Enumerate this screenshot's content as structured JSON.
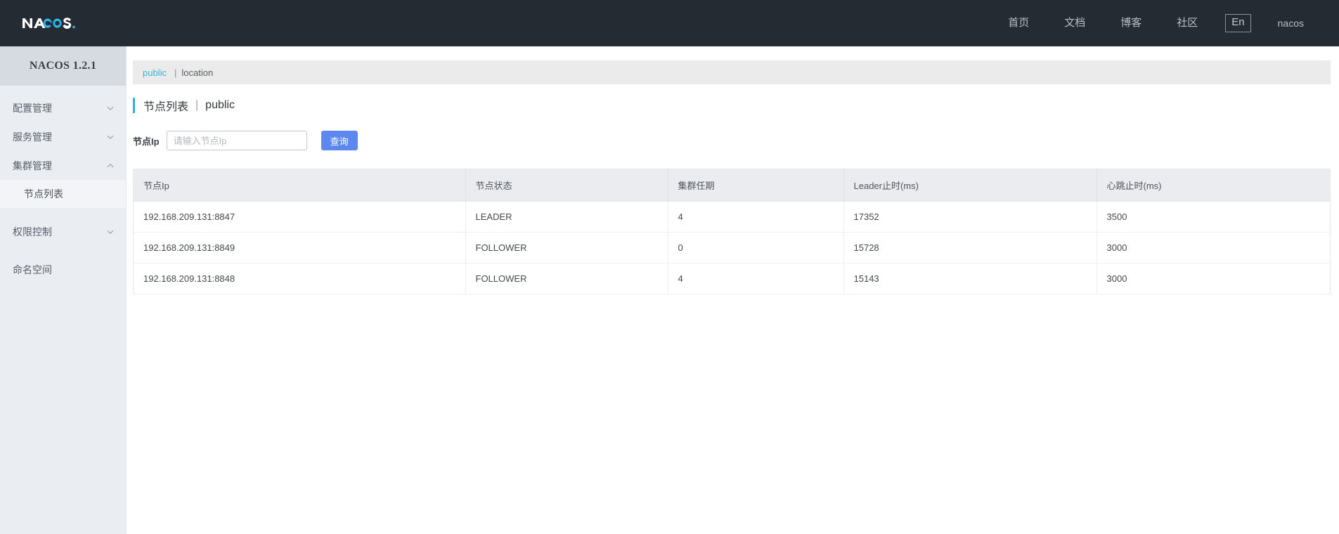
{
  "header": {
    "logo_text": "NACOS.",
    "logo_icon": "nacos-logo-icon",
    "nav_items": [
      {
        "label": "首页",
        "name": "home"
      },
      {
        "label": "文档",
        "name": "docs"
      },
      {
        "label": "博客",
        "name": "blog"
      },
      {
        "label": "社区",
        "name": "community"
      }
    ],
    "lang_toggle": "En",
    "user": "nacos"
  },
  "sidebar": {
    "brand": "NACOS 1.2.1",
    "items": [
      {
        "label": "配置管理",
        "name": "config-management",
        "type": "group",
        "expanded": false,
        "icon": "chevron-down-icon"
      },
      {
        "label": "服务管理",
        "name": "service-management",
        "type": "group",
        "expanded": false,
        "icon": "chevron-down-icon"
      },
      {
        "label": "集群管理",
        "name": "cluster-management",
        "type": "group",
        "expanded": true,
        "icon": "chevron-up-icon"
      },
      {
        "label": "节点列表",
        "name": "node-list",
        "type": "sub",
        "active": true
      },
      {
        "label": "权限控制",
        "name": "authority-control",
        "type": "group",
        "expanded": false,
        "icon": "chevron-down-icon"
      },
      {
        "label": "命名空间",
        "name": "namespace",
        "type": "group",
        "expanded": false,
        "icon": "none"
      }
    ]
  },
  "breadcrumb": {
    "link": "public",
    "separator": "|",
    "current": "location"
  },
  "page": {
    "title": "节点列表",
    "divider": "|",
    "namespace": "public"
  },
  "search": {
    "label": "节点Ip",
    "placeholder": "请输入节点Ip",
    "value": "",
    "button": "查询"
  },
  "table": {
    "columns": [
      {
        "key": "ip",
        "label": "节点Ip"
      },
      {
        "key": "state",
        "label": "节点状态"
      },
      {
        "key": "term",
        "label": "集群任期"
      },
      {
        "key": "leader",
        "label": "Leader止时(ms)"
      },
      {
        "key": "beat",
        "label": "心跳止时(ms)"
      }
    ],
    "rows": [
      {
        "ip": "192.168.209.131:8847",
        "state": "LEADER",
        "term": "4",
        "leader": "17352",
        "beat": "3500"
      },
      {
        "ip": "192.168.209.131:8849",
        "state": "FOLLOWER",
        "term": "0",
        "leader": "15728",
        "beat": "3000"
      },
      {
        "ip": "192.168.209.131:8848",
        "state": "FOLLOWER",
        "term": "4",
        "leader": "15143",
        "beat": "3000"
      }
    ]
  },
  "colors": {
    "header_bg": "#252b33",
    "sidebar_bg": "#eaedf1",
    "accent_cyan": "#29b6d8",
    "primary_blue": "#5d88f0",
    "table_header_bg": "#ebecf0"
  }
}
